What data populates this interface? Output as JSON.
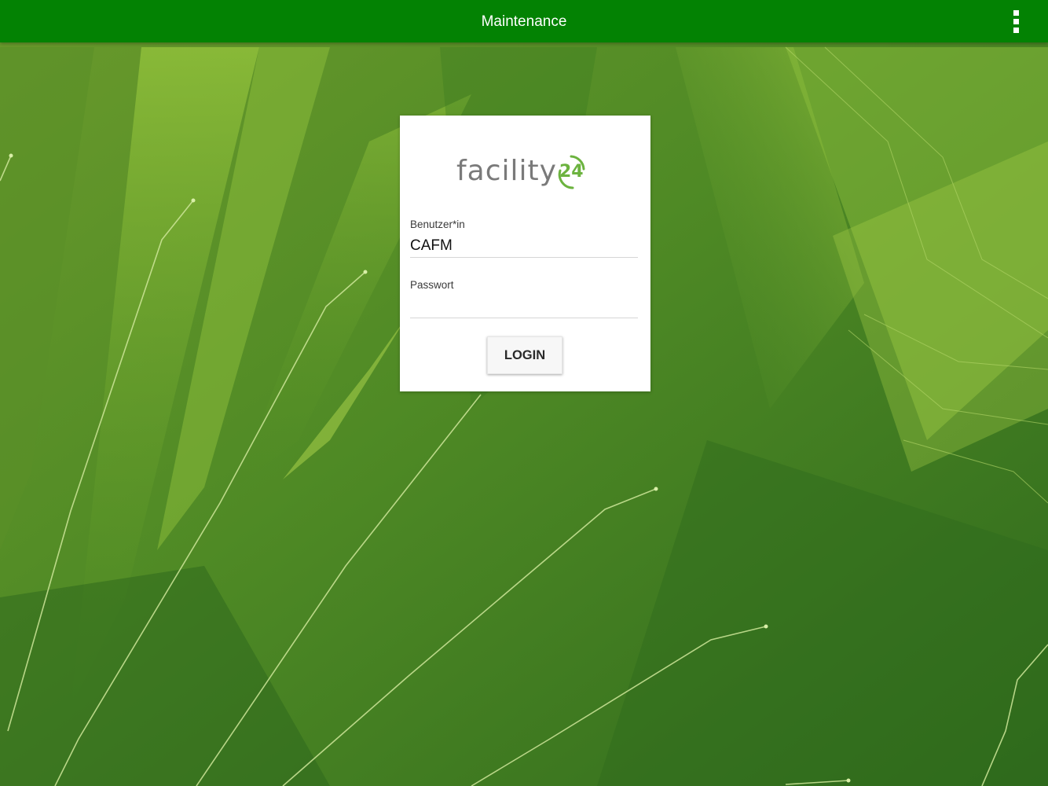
{
  "appbar": {
    "title": "Maintenance",
    "menu_icon": "overflow-menu-icon",
    "color": "#038203"
  },
  "login": {
    "logo_text": "facility",
    "logo_number": "24",
    "username_label": "Benutzer*in",
    "username_value": "CAFM",
    "password_label": "Passwort",
    "password_value": "",
    "login_button": "LOGIN"
  },
  "colors": {
    "accent": "#6cb33f",
    "background": "#3f7a1f"
  }
}
